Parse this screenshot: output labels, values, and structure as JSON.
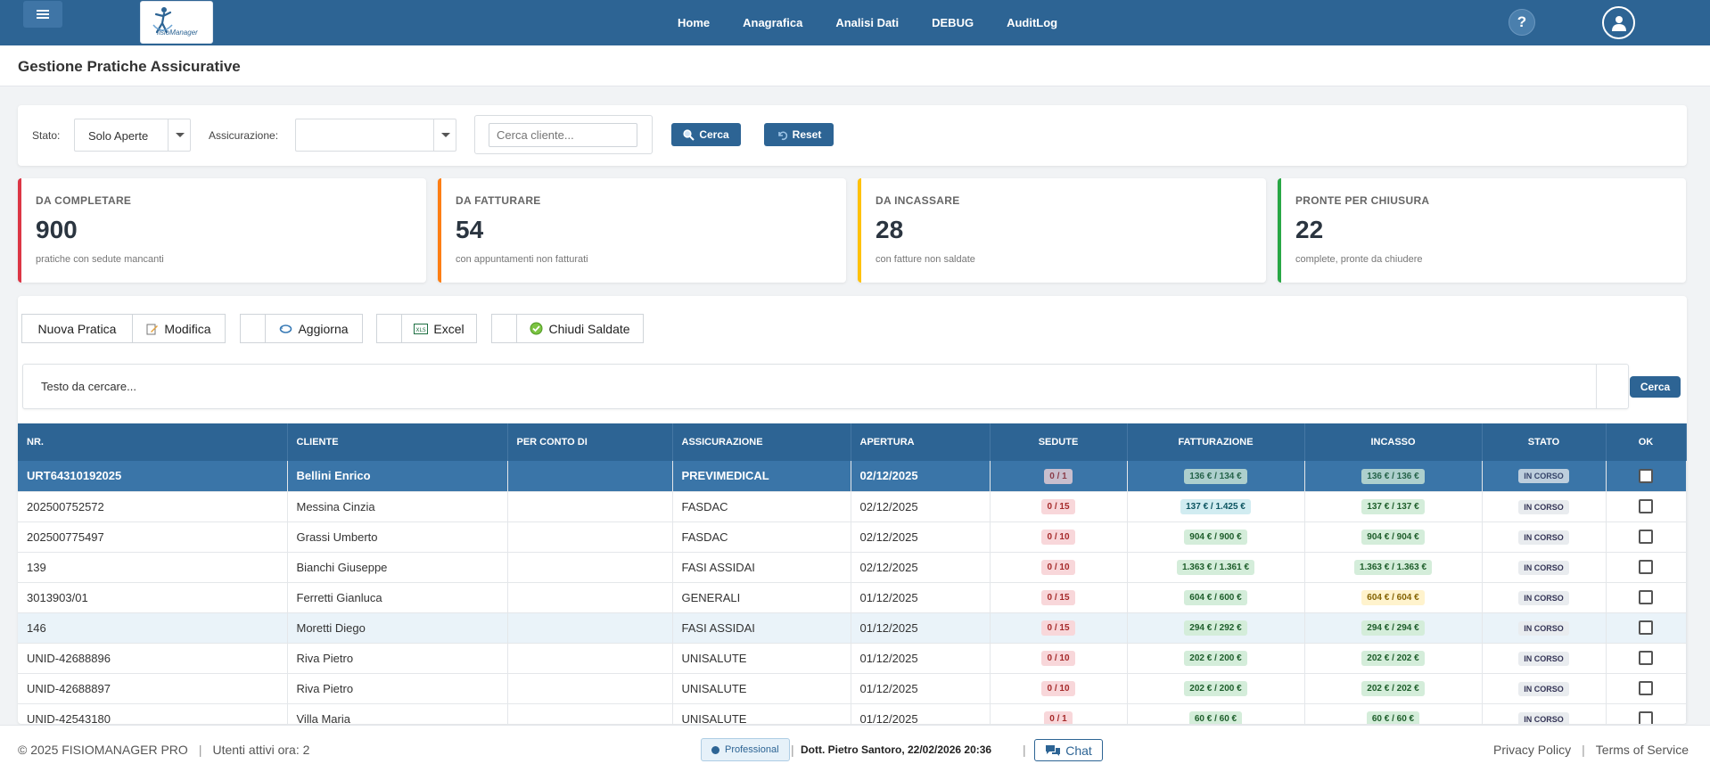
{
  "header": {
    "logo_text": "fisioManager",
    "nav": [
      "Home",
      "Anagrafica",
      "Analisi Dati",
      "DEBUG",
      "AuditLog"
    ],
    "help_label": "?"
  },
  "page": {
    "title": "Gestione Pratiche Assicurative"
  },
  "filters": {
    "stato_label": "Stato:",
    "stato_value": "Solo Aperte",
    "assicurazione_label": "Assicurazione:",
    "assicurazione_value": "",
    "search_placeholder": "Cerca cliente...",
    "cerca_label": "Cerca",
    "reset_label": "Reset"
  },
  "stats": [
    {
      "label": "DA COMPLETARE",
      "value": "900",
      "desc": "pratiche con sedute mancanti",
      "color": "#dc3545"
    },
    {
      "label": "DA FATTURARE",
      "value": "54",
      "desc": "con appuntamenti non fatturati",
      "color": "#fd7e14"
    },
    {
      "label": "DA INCASSARE",
      "value": "28",
      "desc": "con fatture non saldate",
      "color": "#ffc107"
    },
    {
      "label": "PRONTE PER CHIUSURA",
      "value": "22",
      "desc": "complete, pronte da chiudere",
      "color": "#28a745"
    }
  ],
  "toolbar": {
    "nuova": "Nuova Pratica",
    "modifica": "Modifica",
    "aggiorna": "Aggiorna",
    "excel": "Excel",
    "chiudi": "Chiudi Saldate"
  },
  "grid_search": {
    "text": "Testo da cercare...",
    "button": "Cerca"
  },
  "table": {
    "columns": [
      "NR.",
      "CLIENTE",
      "PER CONTO DI",
      "ASSICURAZIONE",
      "APERTURA",
      "SEDUTE",
      "FATTURAZIONE",
      "INCASSO",
      "STATO",
      "OK"
    ],
    "rows": [
      {
        "nr": "URT64310192025",
        "cliente": "Bellini Enrico",
        "conto": "",
        "assic": "PREVIMEDICAL",
        "apertura": "02/12/2025",
        "sedute": "0 / 1",
        "fatt": "136 € / 134 €",
        "fatt_tone": "green",
        "inc": "136 € / 136 €",
        "inc_tone": "green",
        "stato": "IN CORSO"
      },
      {
        "nr": "202500752572",
        "cliente": "Messina Cinzia",
        "conto": "",
        "assic": "FASDAC",
        "apertura": "02/12/2025",
        "sedute": "0 / 15",
        "fatt": "137 € / 1.425 €",
        "fatt_tone": "cyan",
        "inc": "137 € / 137 €",
        "inc_tone": "green",
        "stato": "IN CORSO"
      },
      {
        "nr": "202500775497",
        "cliente": "Grassi Umberto",
        "conto": "",
        "assic": "FASDAC",
        "apertura": "02/12/2025",
        "sedute": "0 / 10",
        "fatt": "904 € / 900 €",
        "fatt_tone": "green",
        "inc": "904 € / 904 €",
        "inc_tone": "green",
        "stato": "IN CORSO"
      },
      {
        "nr": "139",
        "cliente": "Bianchi Giuseppe",
        "conto": "",
        "assic": "FASI ASSIDAI",
        "apertura": "02/12/2025",
        "sedute": "0 / 10",
        "fatt": "1.363 € / 1.361 €",
        "fatt_tone": "green",
        "inc": "1.363 € / 1.363 €",
        "inc_tone": "green",
        "stato": "IN CORSO"
      },
      {
        "nr": "3013903/01",
        "cliente": "Ferretti Gianluca",
        "conto": "",
        "assic": "GENERALI",
        "apertura": "01/12/2025",
        "sedute": "0 / 15",
        "fatt": "604 € / 600 €",
        "fatt_tone": "green",
        "inc": "604 € / 604 €",
        "inc_tone": "yellow",
        "stato": "IN CORSO"
      },
      {
        "nr": "146",
        "cliente": "Moretti Diego",
        "conto": "",
        "assic": "FASI ASSIDAI",
        "apertura": "01/12/2025",
        "sedute": "0 / 15",
        "fatt": "294 € / 292 €",
        "fatt_tone": "green",
        "inc": "294 € / 294 €",
        "inc_tone": "green",
        "stato": "IN CORSO"
      },
      {
        "nr": "UNID-42688896",
        "cliente": "Riva Pietro",
        "conto": "",
        "assic": "UNISALUTE",
        "apertura": "01/12/2025",
        "sedute": "0 / 10",
        "fatt": "202 € / 200 €",
        "fatt_tone": "green",
        "inc": "202 € / 202 €",
        "inc_tone": "green",
        "stato": "IN CORSO"
      },
      {
        "nr": "UNID-42688897",
        "cliente": "Riva Pietro",
        "conto": "",
        "assic": "UNISALUTE",
        "apertura": "01/12/2025",
        "sedute": "0 / 10",
        "fatt": "202 € / 200 €",
        "fatt_tone": "green",
        "inc": "202 € / 202 €",
        "inc_tone": "green",
        "stato": "IN CORSO"
      },
      {
        "nr": "UNID-42543180",
        "cliente": "Villa Maria",
        "conto": "",
        "assic": "UNISALUTE",
        "apertura": "01/12/2025",
        "sedute": "0 / 1",
        "fatt": "60 € / 60 €",
        "fatt_tone": "green",
        "inc": "60 € / 60 €",
        "inc_tone": "green",
        "stato": "IN CORSO"
      }
    ]
  },
  "footer": {
    "copyright": "© 2025 FISIOMANAGER PRO",
    "active_users": "Utenti attivi ora: 2",
    "plan": "Professional",
    "user_datetime": "Dott. Pietro Santoro, 22/02/2026 20:36",
    "chat": "Chat",
    "privacy": "Privacy Policy",
    "terms": "Terms of Service"
  }
}
